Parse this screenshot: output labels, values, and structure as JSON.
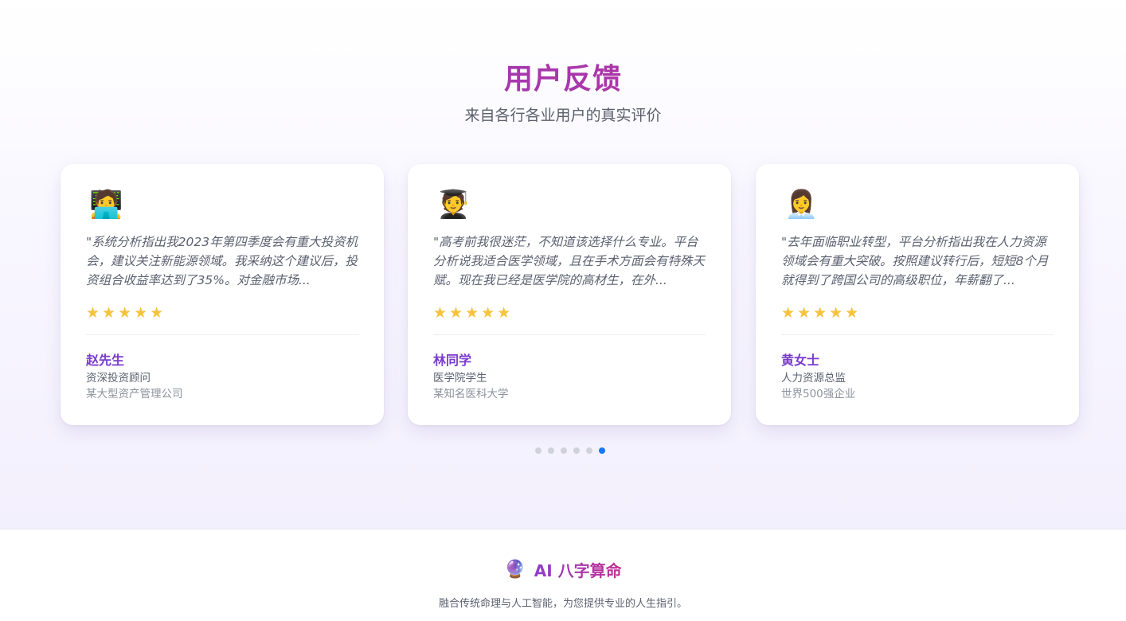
{
  "section": {
    "title": "用户反馈",
    "subtitle": "来自各行各业用户的真实评价"
  },
  "testimonials": [
    {
      "avatar_icon": "man-technologist-emoji",
      "avatar_glyph": "🧑‍💻",
      "quote": "\"系统分析指出我2023年第四季度会有重大投资机会，建议关注新能源领域。我采纳这个建议后，投资组合收益率达到了35%。对金融市场...",
      "stars": "★★★★★",
      "rating": 5,
      "name": "赵先生",
      "role": "资深投资顾问",
      "org": "某大型资产管理公司"
    },
    {
      "avatar_icon": "student-graduate-emoji",
      "avatar_glyph": "🧑‍🎓",
      "quote": "\"高考前我很迷茫，不知道该选择什么专业。平台分析说我适合医学领域，且在手术方面会有特殊天赋。现在我已经是医学院的高材生，在外...",
      "stars": "★★★★★",
      "rating": 5,
      "name": "林同学",
      "role": "医学院学生",
      "org": "某知名医科大学"
    },
    {
      "avatar_icon": "woman-office-worker-emoji",
      "avatar_glyph": "👩‍💼",
      "quote": "\"去年面临职业转型，平台分析指出我在人力资源领域会有重大突破。按照建议转行后，短短8个月就得到了跨国公司的高级职位，年薪翻了...",
      "stars": "★★★★★",
      "rating": 5,
      "name": "黄女士",
      "role": "人力资源总监",
      "org": "世界500强企业"
    }
  ],
  "pagination": {
    "total": 6,
    "active_index": 5
  },
  "footer": {
    "logo_icon": "crystal-ball-icon",
    "logo_glyph": "🔮",
    "brand": "AI 八字算命",
    "tagline": "融合传统命理与人工智能，为您提供专业的人生指引。"
  },
  "colors": {
    "title_gradient_start": "#8e3fc8",
    "title_gradient_end": "#c22f8e",
    "name_color": "#7a3ccc",
    "star_color": "#f7c23c",
    "dot_active": "#1677ff",
    "dot_inactive": "#cfd2da"
  }
}
